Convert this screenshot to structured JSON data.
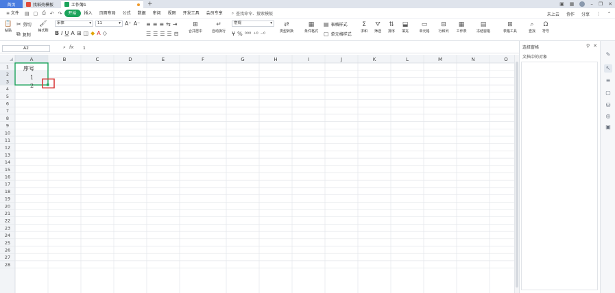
{
  "titlebar": {
    "tabs": [
      {
        "label": "首页"
      },
      {
        "label": "找稻壳模板"
      },
      {
        "label": "工作簿1"
      }
    ],
    "new_tab": "+"
  },
  "menubar": {
    "file": "≡ 文件",
    "items": [
      "开始",
      "插入",
      "页面布局",
      "公式",
      "数据",
      "审阅",
      "视图",
      "开发工具",
      "会员专享"
    ],
    "active": "开始",
    "search": "查找命令、搜索模板",
    "right": [
      "未上云",
      "协作",
      "分享"
    ]
  },
  "ribbon": {
    "paste": "粘贴",
    "cut": "剪切",
    "copy": "复制",
    "format_painter": "格式刷",
    "font": "宋体",
    "size": "11",
    "merge": "合并居中",
    "wrap": "自动换行",
    "number_format": "常规",
    "type_convert": "类型转换",
    "cond_format": "条件格式",
    "table_style": "表格样式",
    "cell_style": "单元格样式",
    "sum": "求和",
    "filter": "筛选",
    "sort": "排序",
    "fill": "填充",
    "cell": "单元格",
    "rowcol": "行和列",
    "sheet": "工作表",
    "freeze": "冻结窗格",
    "table_tools": "表格工具",
    "find": "查找",
    "symbol": "符号"
  },
  "formula_bar": {
    "name_box": "A2",
    "fx": "fx",
    "content": "1"
  },
  "grid": {
    "columns": [
      "A",
      "B",
      "C",
      "D",
      "E",
      "F",
      "G",
      "H",
      "I",
      "J",
      "K",
      "L",
      "M",
      "N",
      "O"
    ],
    "rows": [
      "1",
      "2",
      "3",
      "4",
      "5",
      "6",
      "7",
      "8",
      "9",
      "10",
      "11",
      "12",
      "13",
      "14",
      "15",
      "16",
      "17",
      "18",
      "19",
      "20",
      "21",
      "22",
      "23",
      "24",
      "25",
      "26",
      "27",
      "28"
    ],
    "cells": {
      "A1": "序号",
      "A2": "1",
      "A3": "2"
    }
  },
  "panel": {
    "title": "选择窗格",
    "subtitle": "文档中的对象"
  },
  "colors": {
    "accent": "#1aa35a",
    "home_tab": "#4a7de0",
    "highlight_box": "#d83a3a"
  }
}
